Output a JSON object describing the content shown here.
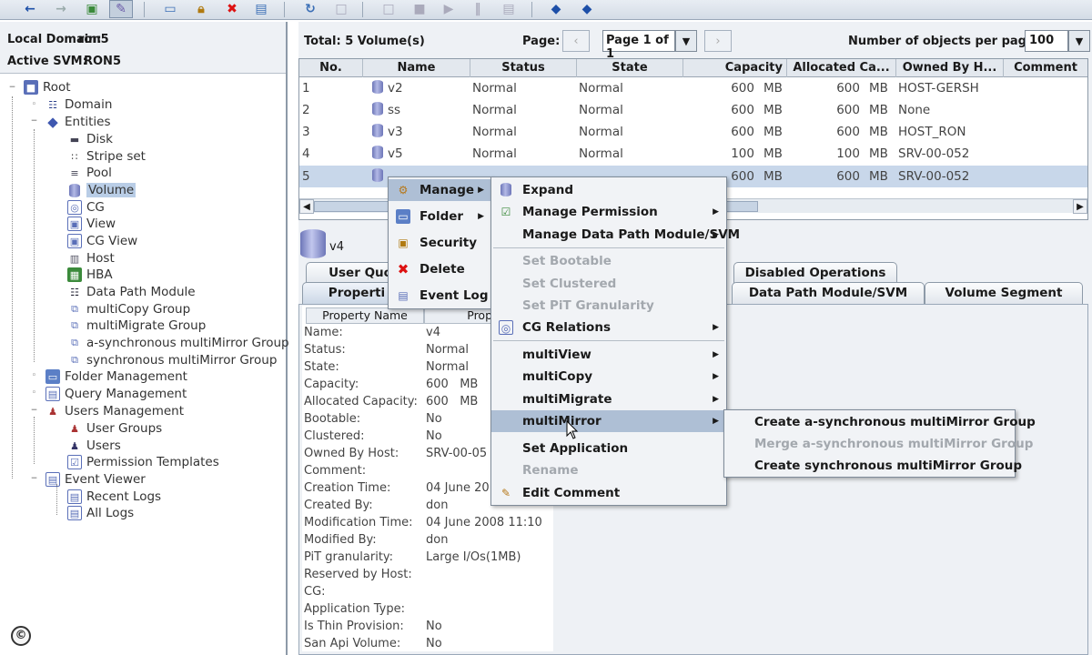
{
  "toolbar": {
    "icons": [
      "back-icon",
      "forward-icon",
      "export-icon",
      "edit-icon",
      "window-icon",
      "lock-icon",
      "delete-icon",
      "paste-icon",
      "refresh-icon",
      "blank-icon",
      "doc-icon",
      "stop-icon",
      "play-icon",
      "pause-icon",
      "print-icon",
      "help-icon",
      "info-icon"
    ]
  },
  "domain": {
    "local_label": "Local Domain:",
    "local_value": "ron5",
    "svm_label": "Active SVM:",
    "svm_value": "RON5"
  },
  "tree": {
    "root": "Root",
    "domain": "Domain",
    "entities": "Entities",
    "disk": "Disk",
    "stripe_set": "Stripe set",
    "pool": "Pool",
    "volume": "Volume",
    "cg": "CG",
    "view": "View",
    "cg_view": "CG View",
    "host": "Host",
    "hba": "HBA",
    "data_path_module": "Data Path Module",
    "multicopy_group": "multiCopy Group",
    "multimigrate_group": "multiMigrate Group",
    "async_mirror_group": "a-synchronous multiMirror Group",
    "sync_mirror_group": "synchronous multiMirror Group",
    "folder_mgmt": "Folder Management",
    "query_mgmt": "Query Management",
    "users_mgmt": "Users Management",
    "user_groups": "User Groups",
    "users": "Users",
    "permission_templates": "Permission Templates",
    "event_viewer": "Event Viewer",
    "recent_logs": "Recent Logs",
    "all_logs": "All Logs"
  },
  "topbar": {
    "total": "Total: 5 Volume(s)",
    "page_label": "Page:",
    "page_value": "Page 1 of 1",
    "objects_label": "Number of objects per page:",
    "objects_value": "100"
  },
  "table": {
    "headers": [
      "No.",
      "Name",
      "Status",
      "State",
      "Capacity",
      "Allocated Ca...",
      "Owned By H...",
      "Comment"
    ],
    "rows": [
      {
        "no": "1",
        "name": "v2",
        "status": "Normal",
        "state": "Normal",
        "cap": "600",
        "cap_u": "MB",
        "alloc": "600",
        "alloc_u": "MB",
        "owner": "HOST-GERSH"
      },
      {
        "no": "2",
        "name": "ss",
        "status": "Normal",
        "state": "Normal",
        "cap": "600",
        "cap_u": "MB",
        "alloc": "600",
        "alloc_u": "MB",
        "owner": "None"
      },
      {
        "no": "3",
        "name": "v3",
        "status": "Normal",
        "state": "Normal",
        "cap": "600",
        "cap_u": "MB",
        "alloc": "600",
        "alloc_u": "MB",
        "owner": "HOST_RON"
      },
      {
        "no": "4",
        "name": "v5",
        "status": "Normal",
        "state": "Normal",
        "cap": "100",
        "cap_u": "MB",
        "alloc": "100",
        "alloc_u": "MB",
        "owner": "SRV-00-052"
      },
      {
        "no": "5",
        "name": "",
        "status": "",
        "state": "",
        "cap": "600",
        "cap_u": "MB",
        "alloc": "600",
        "alloc_u": "MB",
        "owner": "SRV-00-052"
      }
    ]
  },
  "details": {
    "volume_name": "v4",
    "tabs_row1": [
      "User Quo",
      "Disabled Operations"
    ],
    "tabs_row2": [
      "Properti",
      "Data Path Module/SVM",
      "Volume Segment"
    ],
    "prop_header_name": "Property Name",
    "prop_header_value": "Propert",
    "props": [
      {
        "k": "Name:",
        "v": "v4"
      },
      {
        "k": "Status:",
        "v": "Normal"
      },
      {
        "k": "State:",
        "v": "Normal"
      },
      {
        "k": "Capacity:",
        "v": "600   MB"
      },
      {
        "k": "Allocated Capacity:",
        "v": "600   MB"
      },
      {
        "k": "Bootable:",
        "v": "No"
      },
      {
        "k": "Clustered:",
        "v": "No"
      },
      {
        "k": "Owned By Host:",
        "v": "SRV-00-05"
      },
      {
        "k": "Comment:",
        "v": ""
      },
      {
        "k": "Creation Time:",
        "v": "04 June 20"
      },
      {
        "k": "Created By:",
        "v": "don"
      },
      {
        "k": "Modification Time:",
        "v": "04 June 2008 11:10"
      },
      {
        "k": "Modified By:",
        "v": "don"
      },
      {
        "k": "PiT granularity:",
        "v": "Large I/Os(1MB)"
      },
      {
        "k": "Reserved by Host:",
        "v": ""
      },
      {
        "k": "CG:",
        "v": ""
      },
      {
        "k": "Application Type:",
        "v": ""
      },
      {
        "k": "Is Thin Provision:",
        "v": "No"
      },
      {
        "k": "San Api Volume:",
        "v": "No"
      }
    ]
  },
  "context_menu": {
    "manage": "Manage",
    "folder": "Folder",
    "security": "Security",
    "delete": "Delete",
    "event_log": "Event Log"
  },
  "manage_menu": {
    "expand": "Expand",
    "manage_permission": "Manage Permission",
    "manage_dpm": "Manage Data Path Module/SVM",
    "set_bootable": "Set Bootable",
    "set_clustered": "Set Clustered",
    "set_pit": "Set PiT Granularity",
    "cg_relations": "CG Relations",
    "multiview": "multiView",
    "multicopy": "multiCopy",
    "multimigrate": "multiMigrate",
    "multimirror": "multiMirror",
    "set_application": "Set Application",
    "rename": "Rename",
    "edit_comment": "Edit Comment"
  },
  "mirror_menu": {
    "create_async": "Create a-synchronous multiMirror Group",
    "merge_async": "Merge a-synchronous multiMirror Group",
    "create_sync": "Create synchronous multiMirror Group"
  },
  "copyright": "©"
}
